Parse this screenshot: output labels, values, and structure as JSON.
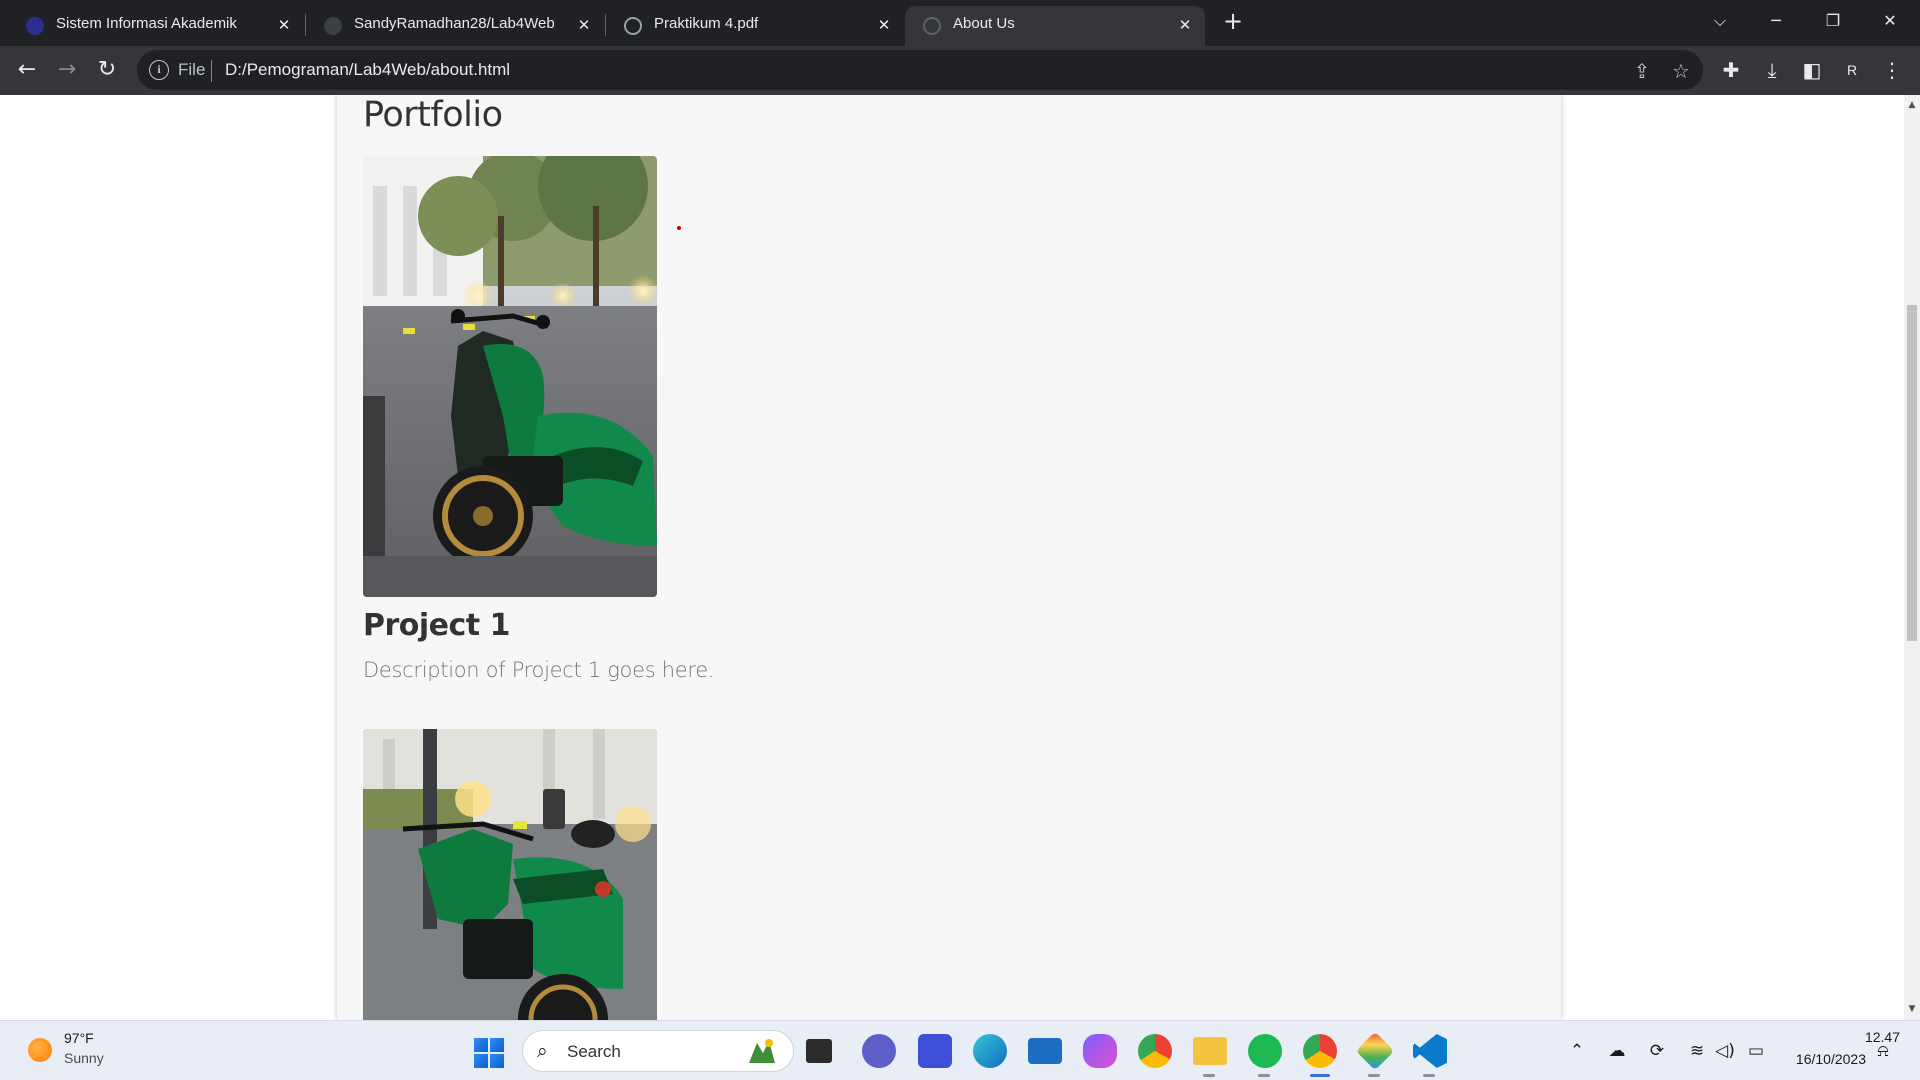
{
  "browser": {
    "tabs": [
      {
        "title": "Sistem Informasi Akademik",
        "icon": "campus-icon",
        "active": false
      },
      {
        "title": "SandyRamadhan28/Lab4Web",
        "icon": "github-icon",
        "active": false
      },
      {
        "title": "Praktikum 4.pdf",
        "icon": "globe-icon",
        "active": false
      },
      {
        "title": "About Us",
        "icon": "globe-icon",
        "active": true
      }
    ],
    "new_tab_label": "+",
    "address": {
      "scheme_label": "File",
      "url": "D:/Pemograman/Lab4Web/about.html"
    },
    "profile_initial": "R"
  },
  "page": {
    "heading": "Portfolio",
    "projects": [
      {
        "title": "Project 1",
        "description": "Description of Project 1 goes here."
      },
      {
        "title": "",
        "description": ""
      }
    ]
  },
  "taskbar": {
    "weather": {
      "temperature": "97°F",
      "condition": "Sunny"
    },
    "search_placeholder": "Search",
    "clock": {
      "time": "12.47",
      "date": "16/10/2023"
    }
  },
  "colors": {
    "tabstrip": "#202124",
    "toolbar": "#35363a",
    "content_bg": "#f7f7f7",
    "scooter_green": "#0f7a3d"
  }
}
